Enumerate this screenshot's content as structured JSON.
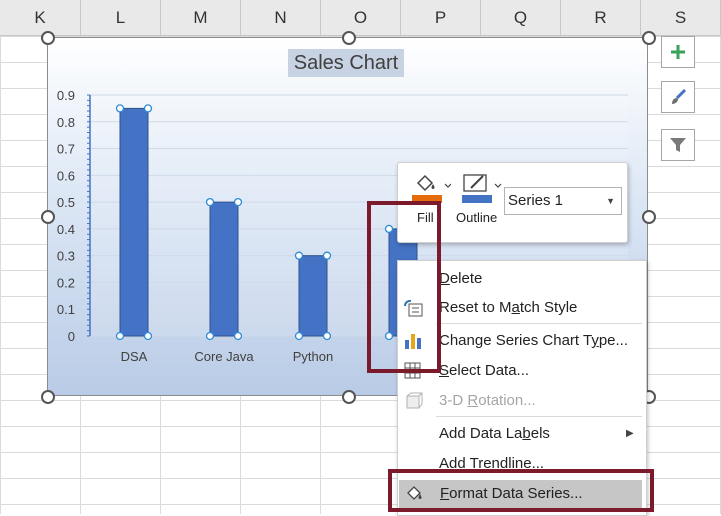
{
  "sheet": {
    "columns": [
      "K",
      "L",
      "M",
      "N",
      "O",
      "P",
      "Q",
      "R",
      "S"
    ]
  },
  "chart": {
    "title": "Sales Chart"
  },
  "chart_data": {
    "type": "bar",
    "categories": [
      "DSA",
      "Core Java",
      "Python",
      ""
    ],
    "values": [
      0.85,
      0.5,
      0.3,
      0.4
    ],
    "series": [
      {
        "values": [
          0.85,
          0.5,
          0.3,
          0.4
        ]
      }
    ],
    "ylim": [
      0,
      0.9
    ],
    "yticks": [
      "0.9",
      "0.8",
      "0.7",
      "0.6",
      "0.5",
      "0.4",
      "0.3",
      "0.2",
      "0.1",
      "0"
    ],
    "visible_category_fragment": "C",
    "grid": true,
    "bar_color": "#4472c4"
  },
  "side_buttons": {
    "chart_elements": "plus-icon",
    "chart_styles": "brush-icon",
    "chart_filters": "filter-icon"
  },
  "mini_toolbar": {
    "fill_label": "Fill",
    "outline_label": "Outline",
    "series_selected": "Series 1",
    "fill_color": "#e46c0a",
    "outline_color": "#4472c4"
  },
  "context_menu": {
    "items": [
      {
        "pre": "",
        "u": "D",
        "post": "elete"
      },
      {
        "pre": "Reset to M",
        "u": "a",
        "post": "tch Style"
      },
      {
        "pre": "Change Series Chart T",
        "u": "y",
        "post": "pe..."
      },
      {
        "pre": "",
        "u": "S",
        "post": "elect Data..."
      },
      {
        "pre": "3-D ",
        "u": "R",
        "post": "otation..."
      },
      {
        "pre": "Add Data La",
        "u": "b",
        "post": "els"
      },
      {
        "pre": "Add T",
        "u": "r",
        "post": "endline..."
      },
      {
        "pre": "",
        "u": "F",
        "post": "ormat Data Series..."
      }
    ]
  },
  "colors": {
    "highlight": "#7b1a2b",
    "accent": "#4472c4"
  }
}
